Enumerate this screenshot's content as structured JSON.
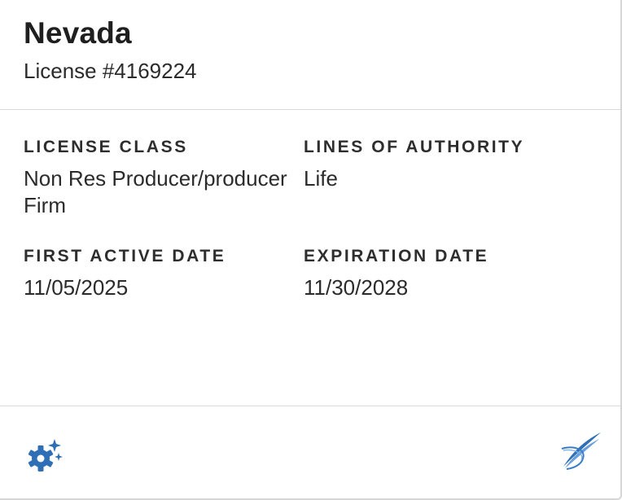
{
  "card": {
    "state": "Nevada",
    "license_number": "License #4169224",
    "fields": {
      "license_class": {
        "label": "LICENSE CLASS",
        "value": "Non Res Producer/producer Firm"
      },
      "lines_of_authority": {
        "label": "LINES OF AUTHORITY",
        "value": "Life"
      },
      "first_active_date": {
        "label": "FIRST ACTIVE DATE",
        "value": "11/05/2025"
      },
      "expiration_date": {
        "label": "EXPIRATION DATE",
        "value": "11/30/2028"
      }
    }
  },
  "footer": {
    "left_icon": "gear-sparkle-icon",
    "right_icon": "swoosh-logo-icon"
  },
  "colors": {
    "accent": "#2f6fb5",
    "divider": "#d9d9d9",
    "text": "#202124"
  }
}
